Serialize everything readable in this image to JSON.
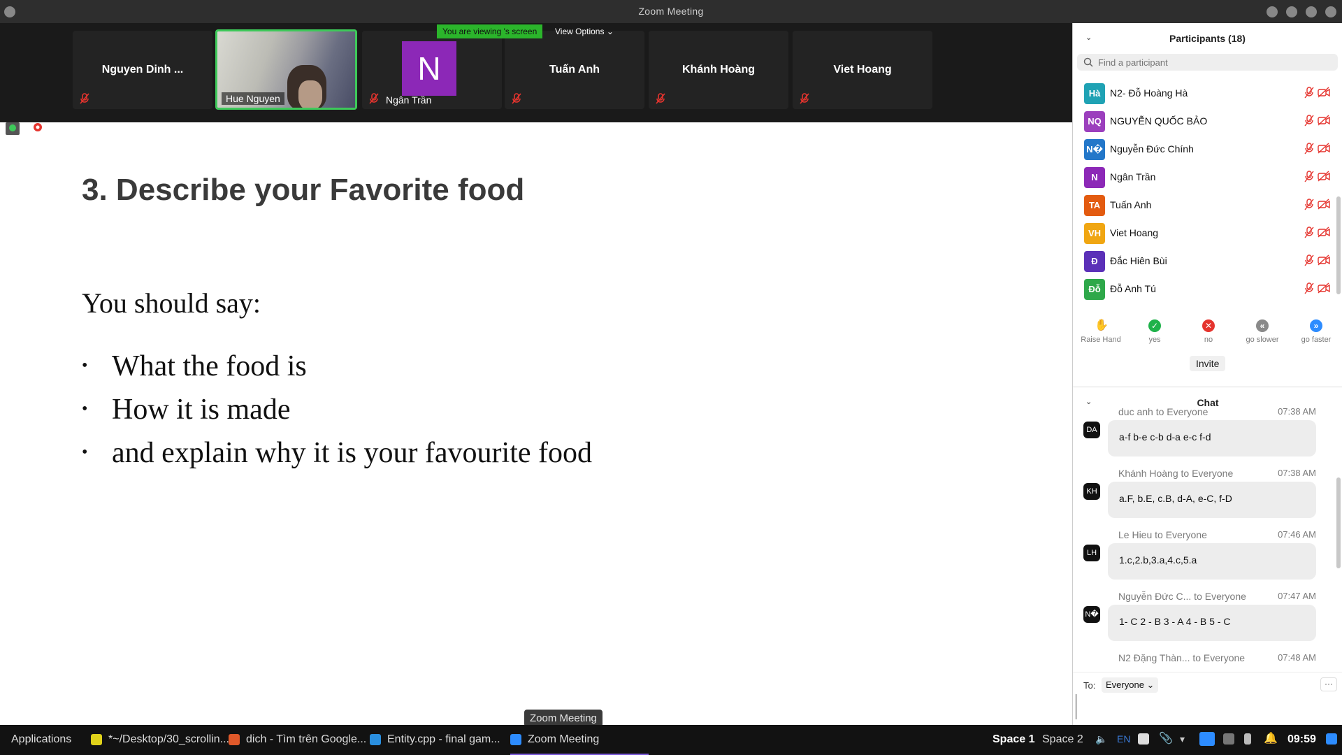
{
  "window": {
    "title": "Zoom Meeting"
  },
  "video_strip": {
    "tiles": [
      {
        "name": "Nguyen Dinh ..."
      },
      {
        "name": "Hue Nguyen"
      },
      {
        "name": "Ngân Trần",
        "initial": "N"
      },
      {
        "name": "Tuấn Anh"
      },
      {
        "name": "Khánh Hoàng"
      },
      {
        "name": "Viet Hoang"
      }
    ],
    "viewing_banner": "You are viewing 's screen",
    "view_options": "View Options"
  },
  "slide": {
    "title": "3. Describe your Favorite food",
    "intro": "You should say:",
    "bullets": [
      "What the food is",
      "How it is made",
      "and explain why it is your favourite food"
    ]
  },
  "tooltip": "Zoom Meeting",
  "participants": {
    "header": "Participants (18)",
    "search_placeholder": "Find a participant",
    "list": [
      {
        "initials": "Hà",
        "name": "N2- Đỗ Hoàng Hà",
        "color": "#1fa2b4"
      },
      {
        "initials": "NQ",
        "name": "NGUYỄN QUỐC BẢO",
        "color": "#9b3fbd"
      },
      {
        "initials": "N�",
        "name": "Nguyễn Đức Chính",
        "color": "#2377c9"
      },
      {
        "initials": "N",
        "name": "Ngân Trần",
        "color": "#8c28b7"
      },
      {
        "initials": "TA",
        "name": "Tuấn Anh",
        "color": "#e35b10"
      },
      {
        "initials": "VH",
        "name": "Viet Hoang",
        "color": "#f0a612"
      },
      {
        "initials": "Đ",
        "name": "Đắc Hiên Bùi",
        "color": "#5b30b8"
      },
      {
        "initials": "Đỗ",
        "name": "Đỗ Anh Tú",
        "color": "#2ea84a"
      }
    ],
    "reactions": [
      {
        "label": "Raise Hand",
        "icon": "raise-hand-icon",
        "color": "#2d8cff"
      },
      {
        "label": "yes",
        "icon": "check-icon",
        "color": "#1fb24a"
      },
      {
        "label": "no",
        "icon": "x-icon",
        "color": "#e5342e"
      },
      {
        "label": "go slower",
        "icon": "rewind-icon",
        "color": "#8a8a8a"
      },
      {
        "label": "go faster",
        "icon": "fast-forward-icon",
        "color": "#2d8cff"
      }
    ],
    "invite_label": "Invite"
  },
  "chat": {
    "header": "Chat",
    "messages": [
      {
        "avatar": "DA",
        "sender": "duc anh to Everyone",
        "time": "07:38 AM",
        "text": "a-f b-e c-b d-a e-c f-d"
      },
      {
        "avatar": "KH",
        "sender": "Khánh Hoàng to Everyone",
        "time": "07:38 AM",
        "text": "a.F, b.E, c.B, d-A, e-C, f-D"
      },
      {
        "avatar": "LH",
        "sender": "Le Hieu to Everyone",
        "time": "07:46 AM",
        "text": "1.c,2.b,3.a,4.c,5.a"
      },
      {
        "avatar": "N�",
        "sender": "Nguyễn Đức C... to Everyone",
        "time": "07:47 AM",
        "text": "1- C 2 - B 3 - A 4 - B 5 - C"
      },
      {
        "avatar": "",
        "sender": "N2 Đặng Thàn... to Everyone",
        "time": "07:48 AM",
        "text": ""
      }
    ],
    "to_label": "To:",
    "to_value": "Everyone",
    "more": "···"
  },
  "taskbar": {
    "applications": "Applications",
    "items": [
      {
        "label": "*~/Desktop/30_scrollin...",
        "color": "#e0d21a"
      },
      {
        "label": "dich - Tìm trên Google...",
        "color": "#e0592a"
      },
      {
        "label": "Entity.cpp - final gam...",
        "color": "#2a8fe0"
      },
      {
        "label": "Zoom Meeting",
        "color": "#2d8cff"
      }
    ],
    "space1": "Space 1",
    "space2": "Space 2",
    "lang": "EN",
    "clock": "09:59"
  }
}
